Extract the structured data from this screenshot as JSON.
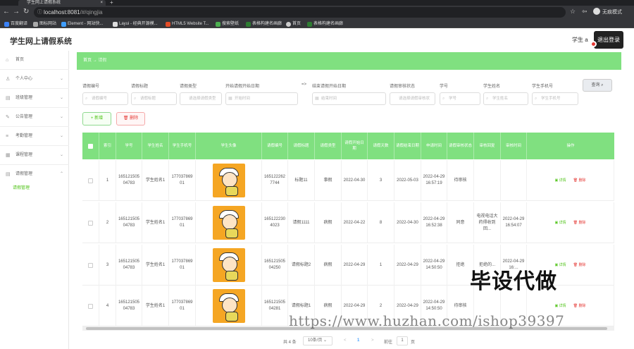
{
  "browser": {
    "tab_title": "学生网上请假系统",
    "url_host": "localhost:8081",
    "url_path": "/#/qingjia",
    "profile_label": "无痕模式",
    "bookmarks": [
      "百度翻译",
      "图标网站",
      "Element - 网站快...",
      "Layui - 经典开源模...",
      "HTML5 Website T...",
      "搜索壁纸",
      "表格构建名画廊",
      "首页",
      "表格构建名画廊"
    ]
  },
  "app": {
    "title": "学生网上请假系统",
    "user_label": "学生 a",
    "logout_label": "退出登录"
  },
  "sidebar": {
    "items": [
      {
        "label": "首页",
        "icon": "home-icon"
      },
      {
        "label": "个人中心",
        "icon": "user-icon"
      },
      {
        "label": "班级管理",
        "icon": "class-icon"
      },
      {
        "label": "公告管理",
        "icon": "notice-icon"
      },
      {
        "label": "考勤管理",
        "icon": "attendance-icon"
      },
      {
        "label": "课程管理",
        "icon": "course-icon"
      },
      {
        "label": "请假管理",
        "icon": "leave-icon"
      }
    ],
    "sub_item": "请假管理"
  },
  "breadcrumb": {
    "home": "首页",
    "sep": "→",
    "current": "请假"
  },
  "filters": {
    "labels": [
      "请假编号",
      "请假标题",
      "请假类型",
      "开始请假开始日期",
      "=>",
      "结束请假开始日期",
      "请假审核状态",
      "学号",
      "学生姓名",
      "学生手机号"
    ],
    "placeholders": [
      "请假编号",
      "请假标题",
      "请选择请假类型",
      "开始时间",
      "结束时间",
      "请选择请假审核状",
      "学号",
      "学生姓名",
      "学生手机号"
    ],
    "query_label": "查询"
  },
  "actions": {
    "add_label": "新增",
    "delete_label": "删除"
  },
  "table": {
    "headers": [
      "索引",
      "学号",
      "学生姓名",
      "学生手机号",
      "学生头像",
      "请假编号",
      "请假标题",
      "请假类型",
      "请假开始日期",
      "请假天数",
      "请假结束日期",
      "申请时间",
      "请假审核状态",
      "审核回复",
      "审核时间",
      "操作"
    ],
    "rows": [
      {
        "index": "1",
        "xuehao": "16512150504783",
        "name": "学生姓名1",
        "phone": "17703786901",
        "bianhao": "1651222627744",
        "title": "标题11",
        "type": "事假",
        "start": "2022-04-30",
        "days": "3",
        "end": "2022-05-03",
        "apply": "2022-04-29 16:57:19",
        "status": "待审核",
        "reply": "",
        "audit": ""
      },
      {
        "index": "2",
        "xuehao": "16512150504783",
        "name": "学生姓名1",
        "phone": "17703786901",
        "bianhao": "1651222304023",
        "title": "请假1111",
        "type": "病假",
        "start": "2022-04-22",
        "days": "8",
        "end": "2022-04-30",
        "apply": "2022-04-29 16:52:38",
        "status": "同意",
        "reply": "电视电话大药得收到回...",
        "audit": "2022-04-29 16:54:07"
      },
      {
        "index": "3",
        "xuehao": "16512150504783",
        "name": "学生姓名1",
        "phone": "17703786901",
        "bianhao": "16512150504250",
        "title": "请假标题2",
        "type": "病假",
        "start": "2022-04-29",
        "days": "1",
        "end": "2022-04-29",
        "apply": "2022-04-29 14:50:50",
        "status": "拒绝",
        "reply": "拒绝的...",
        "audit": "2022-04-29 16:..."
      },
      {
        "index": "4",
        "xuehao": "16512150504783",
        "name": "学生姓名1",
        "phone": "17703786901",
        "bianhao": "16512150504281",
        "title": "请假标题1",
        "type": "病假",
        "start": "2022-04-29",
        "days": "2",
        "end": "2022-04-29",
        "apply": "2022-04-29 14:50:50",
        "status": "待审核",
        "reply": "",
        "audit": ""
      }
    ],
    "op_detail": "详情",
    "op_delete": "删除"
  },
  "pagination": {
    "total": "共 4 条",
    "page_size": "10条/页",
    "prev": "<",
    "page": "1",
    "next": ">",
    "goto": "前往",
    "goto_value": "1",
    "page_unit": "页"
  },
  "watermarks": {
    "big": "毕设代做",
    "url": "https://www.huzhan.com/ishop39397"
  },
  "colors": {
    "accent": "#80e080",
    "danger": "#e53935",
    "success": "#52c41a"
  }
}
